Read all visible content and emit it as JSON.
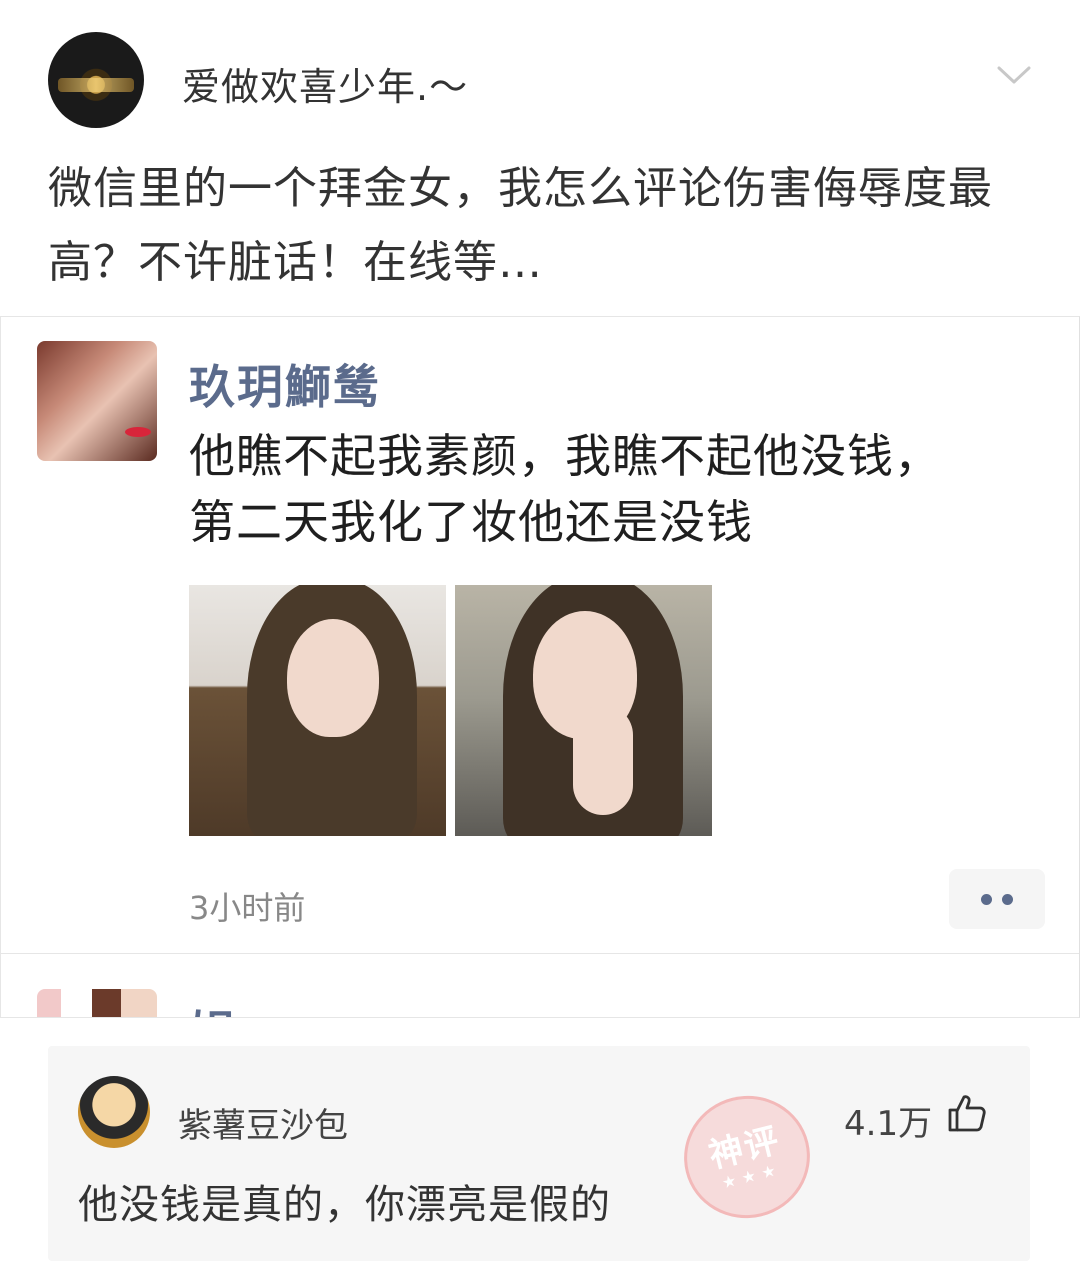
{
  "post": {
    "author": "爱做欢喜少年.～",
    "text": "微信里的一个拜金女，我怎么评论伤害侮辱度最高？不许脏话！在线等…"
  },
  "screenshot": {
    "comment": {
      "author": "玖玥鰤鸶",
      "line1": "他瞧不起我素颜，我瞧不起他没钱，",
      "line2": "第二天我化了妆他还是没钱",
      "time": "3小时前"
    },
    "next_comment_author_partial": "娼"
  },
  "hot_comment": {
    "author": "紫薯豆沙包",
    "likes": "4.1万",
    "text": "他没钱是真的，你漂亮是假的",
    "stamp_label": "神评",
    "stamp_stars": "★★★"
  },
  "colors": {
    "link_name": "#5b6b8c",
    "stamp": "#f6c4c4"
  }
}
